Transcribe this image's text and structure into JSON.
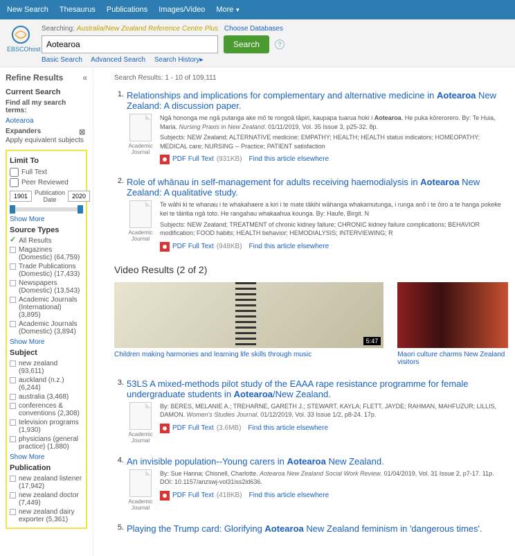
{
  "topnav": {
    "new_search": "New Search",
    "thesaurus": "Thesaurus",
    "publications": "Publications",
    "images": "Images/Video",
    "more": "More"
  },
  "brand": {
    "host": "EBSCOhost"
  },
  "search": {
    "searching_prefix": "Searching:",
    "database": "Australia/New Zealand Reference Centre Plus",
    "choose": "Choose Databases",
    "value": "Aotearoa",
    "button": "Search",
    "basic": "Basic Search",
    "advanced": "Advanced Search",
    "history": "Search History"
  },
  "refine": {
    "heading": "Refine Results",
    "current": "Current Search",
    "find_all": "Find all my search terms:",
    "term": "Aotearoa",
    "expanders": "Expanders",
    "apply_equiv": "Apply equivalent subjects"
  },
  "limit": {
    "heading": "Limit To",
    "full_text": "Full Text",
    "peer": "Peer Reviewed",
    "from": "1901",
    "to": "2020",
    "pubdate": "Publication Date",
    "showmore": "Show More"
  },
  "source_types": {
    "heading": "Source Types",
    "all": "All Results",
    "items": [
      {
        "label": "Magazines (Domestic) (64,759)"
      },
      {
        "label": "Trade Publications (Domestic) (17,433)"
      },
      {
        "label": "Newspapers (Domestic) (13,543)"
      },
      {
        "label": "Academic Journals (International) (3,895)"
      },
      {
        "label": "Academic Journals (Domestic) (3,894)"
      }
    ],
    "showmore": "Show More"
  },
  "subject": {
    "heading": "Subject",
    "items": [
      {
        "label": "new zealand (93,611)"
      },
      {
        "label": "auckland (n.z.) (6,244)"
      },
      {
        "label": "australia (3,468)"
      },
      {
        "label": "conferences & conventions (2,308)"
      },
      {
        "label": "television programs (1,930)"
      },
      {
        "label": "physicians (general practice) (1,880)"
      }
    ],
    "showmore": "Show More"
  },
  "publication": {
    "heading": "Publication",
    "items": [
      {
        "label": "new zealand listener (17,942)"
      },
      {
        "label": "new zealand doctor (7,449)"
      },
      {
        "label": "new zealand dairy exporter (5,361)"
      }
    ]
  },
  "results_hdr": {
    "prefix": "Search Results: ",
    "range": "1 - 10 of 109,111"
  },
  "results": [
    {
      "num": "1.",
      "title_pre": "Relationships and implications for complementary and alternative medicine in ",
      "title_hl": "Aotearoa",
      "title_post": " New Zealand: A discussion paper.",
      "thumb_label": "Academic Journal",
      "snippet_pre": "Ngā hononga me ngā putanga ake mō te rongoā tāpiri, kaupapa tuarua hoki i ",
      "snippet_hl": "Aotearoa",
      "snippet_post": ". He puka kōrerorero. By: Te Huia, Maria. ",
      "src": "Nursing Praxis in New Zealand",
      "cite": ". 01/11/2019, Vol. 35 Issue 3, p25-32. 8p.",
      "subjects": "Subjects: NEW Zealand; ALTERNATIVE medicine; EMPATHY; HEALTH; HEALTH status indicators; HOMEOPATHY; MEDICAL care; NURSING -- Practice; PATIENT satisfaction",
      "pdf": "PDF Full Text",
      "size": "(931KB)",
      "elsewhere": "Find this article elsewhere"
    },
    {
      "num": "2.",
      "title_pre": "Role of whānau in self-management for adults receiving haemodialysis in ",
      "title_hl": "Aotearoa",
      "title_post": " New Zealand: A qualitative study.",
      "thumb_label": "Academic Journal",
      "snippet_pre": "Te wāhi ki te whanau i te whakahaere a kiri i te mate tākihi wāhanga whakamutunga, i runga anō i te ōiro a te hanga pokeke kei te tāiritia ngā toto. He rangahau whakaahua kounga. By: Haufe, Birgit. N",
      "subjects": "Subjects: NEW Zealand; TREATMENT of chronic kidney failure; CHRONIC kidney failure complications; BEHAVIOR modification; FOOD habits; HEALTH behavior; HEMODIALYSIS; INTERVIEWING; R",
      "pdf": "PDF Full Text",
      "size": "(948KB)",
      "elsewhere": "Find this article elsewhere"
    },
    {
      "num": "3.",
      "title_pre": "53LS A mixed-methods pilot study of the EAAA rape resistance programme for female undergraduate students in ",
      "title_hl": "Aotearoa",
      "title_post": "/New Zealand.",
      "thumb_label": "Academic Journal",
      "snippet_pre": "By: BERES, MELANIE A.; TREHARNE, GARETH J.; STEWART, KAYLA; FLETT, JAYDE; RAHMAN, MAHFUZUR; LILLIS, DAMON. ",
      "src": "Women's Studies Journal",
      "cite": ". 01/12/2019, Vol. 33 Issue 1/2, p8-24. 17p.",
      "pdf": "PDF Full Text",
      "size": "(3.6MB)",
      "elsewhere": "Find this article elsewhere"
    },
    {
      "num": "4.",
      "title_pre": "An invisible population--Young carers in ",
      "title_hl": "Aotearoa",
      "title_post": " New Zealand.",
      "thumb_label": "Academic Journal",
      "snippet_pre": "By: Sue Hanna; Chisnell, Charlotte. ",
      "src": "Aotearoa New Zealand Social Work Review",
      "cite": ". 01/04/2019, Vol. 31 Issue 2, p7-17. 11p. DOI: 10.1157/anzswj-vol31iss2id636.",
      "pdf": "PDF Full Text",
      "size": "(418KB)",
      "elsewhere": "Find this article elsewhere"
    },
    {
      "num": "5.",
      "title_pre": "Playing the Trump card: Glorifying ",
      "title_hl": "Aotearoa",
      "title_post": " New Zealand feminism in 'dangerous times'."
    }
  ],
  "videos": {
    "heading": "Video Results (2 of 2)",
    "items": [
      {
        "title": "Children making harmonies and learning life skills through music",
        "duration": "5:47"
      },
      {
        "title": "Maori culture charms New Zealand visitors",
        "duration": ""
      }
    ]
  }
}
